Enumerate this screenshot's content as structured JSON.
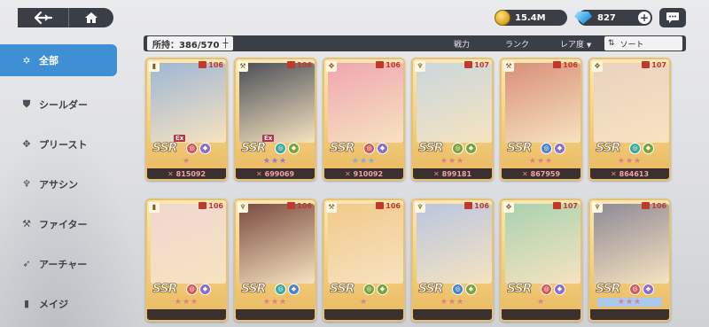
{
  "resources": {
    "gold": "15.4M",
    "gems": "827"
  },
  "filter": {
    "owned_label": "所持：386/570",
    "sort_power": "戦力",
    "sort_rank": "ランク",
    "sort_rarity": "レア度",
    "sort_button": "ソート"
  },
  "sidebar": {
    "items": [
      {
        "label": "全部",
        "icon": "star-icon",
        "active": true
      },
      {
        "label": "シールダー",
        "icon": "shield-icon",
        "active": false
      },
      {
        "label": "プリースト",
        "icon": "priest-icon",
        "active": false
      },
      {
        "label": "アサシン",
        "icon": "assassin-icon",
        "active": false
      },
      {
        "label": "ファイター",
        "icon": "fighter-icon",
        "active": false
      },
      {
        "label": "アーチャー",
        "icon": "archer-icon",
        "active": false
      },
      {
        "label": "メイジ",
        "icon": "book-icon",
        "active": false
      }
    ]
  },
  "cards": [
    {
      "level": "106",
      "rarity": "SSR",
      "ex": "Ex",
      "stars": "★",
      "power": "815092",
      "art": "#9fb6d6"
    },
    {
      "level": "106",
      "rarity": "SSR",
      "ex": "Ex",
      "stars": "★★★",
      "power": "699069",
      "art": "#4a4f57"
    },
    {
      "level": "106",
      "rarity": "SSR",
      "ex": "",
      "stars": "★★★",
      "power": "910092",
      "art": "#f0a6b0"
    },
    {
      "level": "107",
      "rarity": "SSR",
      "ex": "",
      "stars": "★★★",
      "power": "899181",
      "art": "#c9d7dc"
    },
    {
      "level": "106",
      "rarity": "SSR",
      "ex": "",
      "stars": "★★★",
      "power": "867959",
      "art": "#d98f78"
    },
    {
      "level": "107",
      "rarity": "SSR",
      "ex": "",
      "stars": "★★★",
      "power": "864613",
      "art": "#e9d2c0"
    },
    {
      "level": "106",
      "rarity": "SSR",
      "ex": "",
      "stars": "★★★",
      "power": "",
      "art": "#f0d7d0"
    },
    {
      "level": "106",
      "rarity": "SSR",
      "ex": "",
      "stars": "★★★",
      "power": "",
      "art": "#7a4a40"
    },
    {
      "level": "106",
      "rarity": "SSR",
      "ex": "",
      "stars": "★",
      "power": "",
      "art": "#f2c98a"
    },
    {
      "level": "106",
      "rarity": "SSR",
      "ex": "",
      "stars": "★★★",
      "power": "",
      "art": "#b9c6e0"
    },
    {
      "level": "107",
      "rarity": "SSR",
      "ex": "",
      "stars": "★",
      "power": "",
      "art": "#a9d2b0"
    },
    {
      "level": "106",
      "rarity": "SSR",
      "ex": "",
      "stars": "★★★",
      "power": "",
      "art": "#8e8a96"
    }
  ]
}
